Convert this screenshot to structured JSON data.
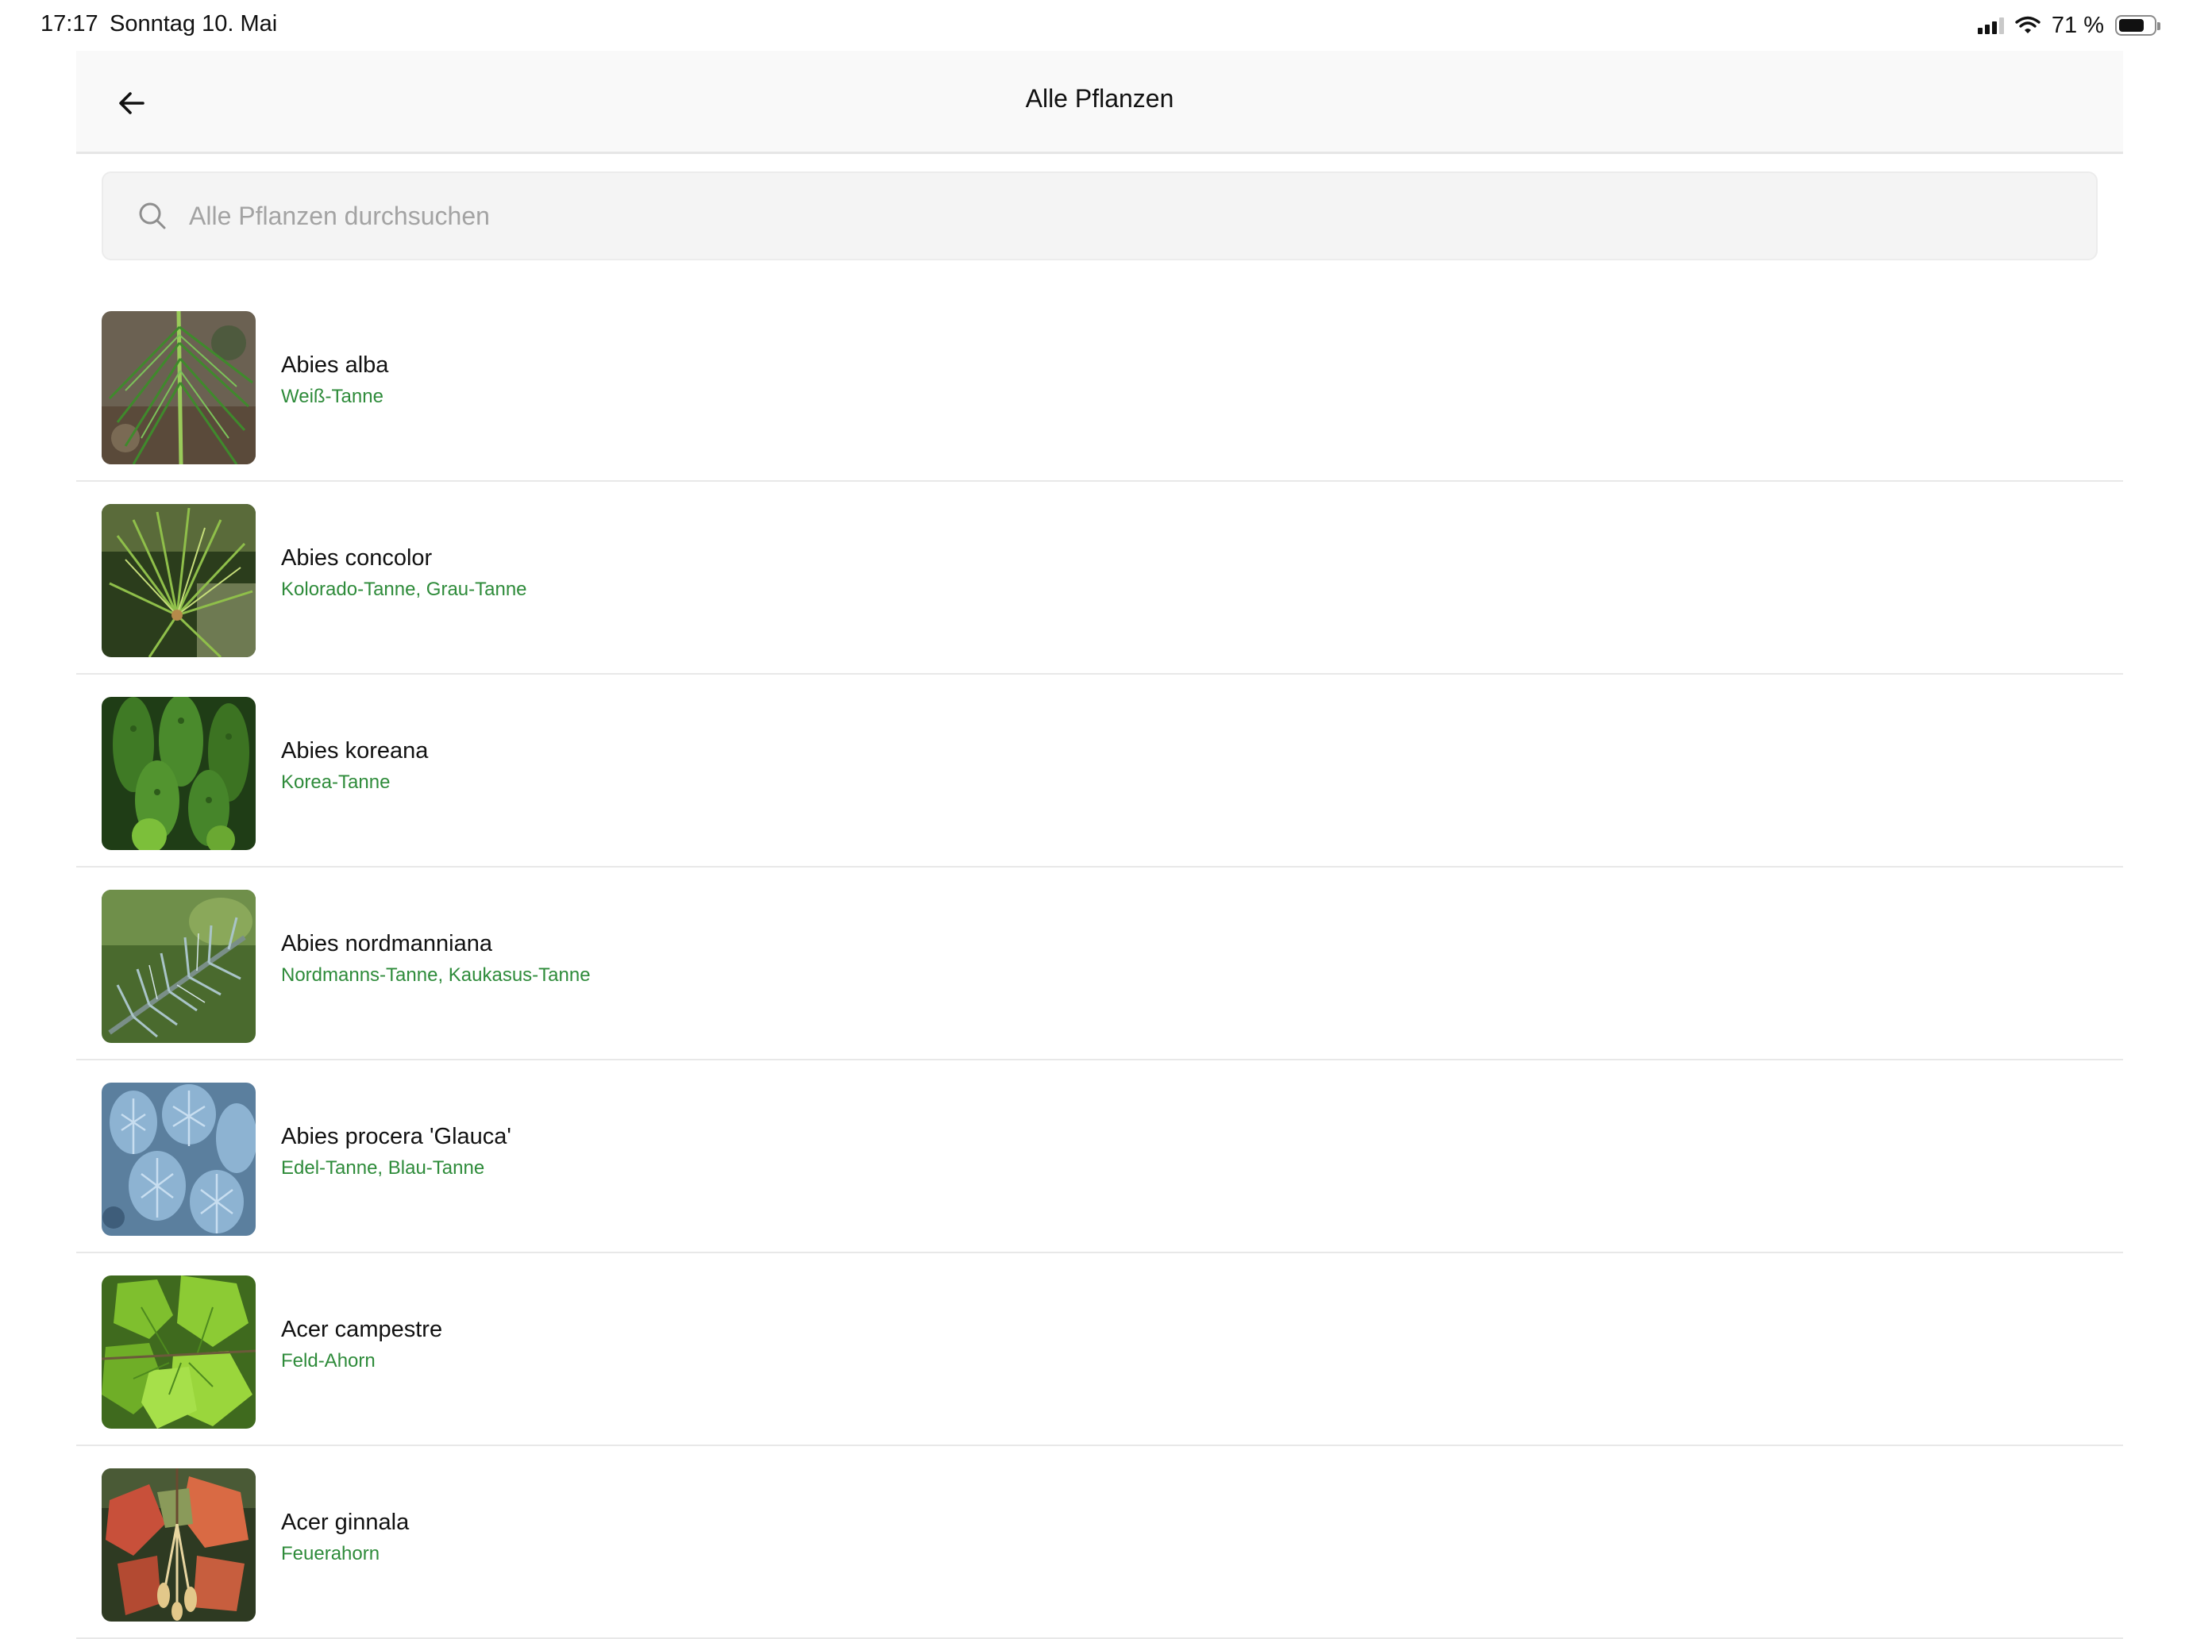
{
  "status_bar": {
    "time": "17:17",
    "date": "Sonntag 10. Mai",
    "battery_percent": "71 %",
    "battery_level": 0.71,
    "icons": [
      "cellular-signal-icon",
      "wifi-icon",
      "battery-icon"
    ]
  },
  "nav": {
    "title": "Alle Pflanzen",
    "back_icon": "arrow-left-icon"
  },
  "search": {
    "placeholder": "Alle Pflanzen durchsuchen",
    "value": "",
    "icon": "search-icon"
  },
  "colors": {
    "accent_green": "#2e8b3a",
    "nav_background": "#f9f9f9",
    "search_background": "#f4f4f4"
  },
  "plants": [
    {
      "name": "Abies alba",
      "common": "Weiß-Tanne",
      "thumb": "needles-green"
    },
    {
      "name": "Abies concolor",
      "common": "Kolorado-Tanne, Grau-Tanne",
      "thumb": "long-needles"
    },
    {
      "name": "Abies koreana",
      "common": "Korea-Tanne",
      "thumb": "dense-shoots"
    },
    {
      "name": "Abies nordmanniana",
      "common": "Nordmanns-Tanne, Kaukasus-Tanne",
      "thumb": "blue-green-branch"
    },
    {
      "name": "Abies procera 'Glauca'",
      "common": "Edel-Tanne, Blau-Tanne",
      "thumb": "blue-needles"
    },
    {
      "name": "Acer campestre",
      "common": "Feld-Ahorn",
      "thumb": "green-leaves"
    },
    {
      "name": "Acer ginnala",
      "common": "Feuerahorn",
      "thumb": "red-leaves"
    }
  ]
}
